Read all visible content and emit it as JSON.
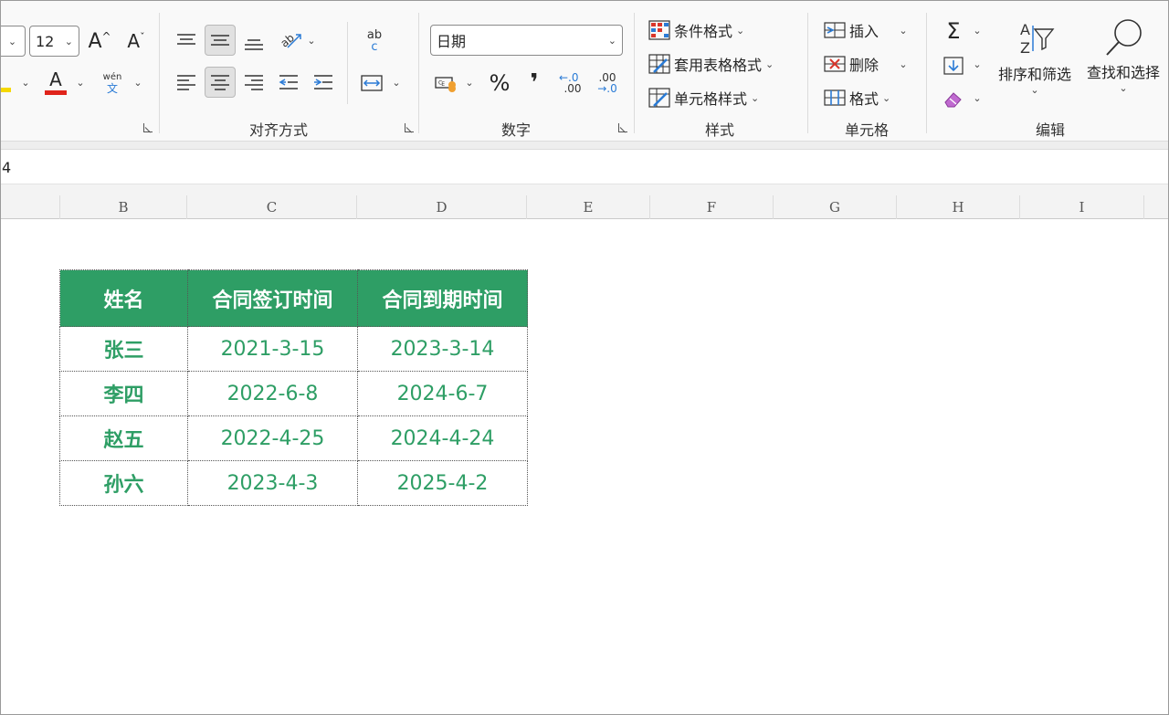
{
  "ribbon": {
    "font": {
      "size_value": "12"
    },
    "groups": {
      "alignment_label": "对齐方式",
      "number_label": "数字",
      "styles_label": "样式",
      "cells_label": "单元格",
      "editing_label": "编辑"
    },
    "font_tools": {
      "grow": "A",
      "shrink": "A",
      "font_color": "A",
      "phonetic_top": "wén",
      "phonetic_bottom": "文"
    },
    "wrap_icon": {
      "top": "ab",
      "bottom": "c"
    },
    "number": {
      "format_value": "日期",
      "percent": "%",
      "comma": "❜",
      "inc_decimal": ".00",
      "dec_decimal": ".00"
    },
    "styles": {
      "conditional_format": "条件格式",
      "table_format": "套用表格格式",
      "cell_styles": "单元格样式"
    },
    "cells": {
      "insert": "插入",
      "delete": "删除",
      "format": "格式"
    },
    "editing": {
      "autosum": "Σ",
      "sort_filter": "排序和筛选",
      "find_select": "查找和选择"
    }
  },
  "formula_bar": {
    "content": "4"
  },
  "columns": [
    "B",
    "C",
    "D",
    "E",
    "F",
    "G",
    "H",
    "I"
  ],
  "table": {
    "headers": [
      "姓名",
      "合同签订时间",
      "合同到期时间"
    ],
    "rows": [
      [
        "张三",
        "2021-3-15",
        "2023-3-14"
      ],
      [
        "李四",
        "2022-6-8",
        "2024-6-7"
      ],
      [
        "赵五",
        "2022-4-25",
        "2024-4-24"
      ],
      [
        "孙六",
        "2023-4-3",
        "2025-4-2"
      ]
    ]
  },
  "colors": {
    "header_fill": "#2e9e65",
    "body_text": "#2e9e65",
    "font_color_bar": "#e0241b",
    "fill_color_bar": "#f5d800"
  }
}
